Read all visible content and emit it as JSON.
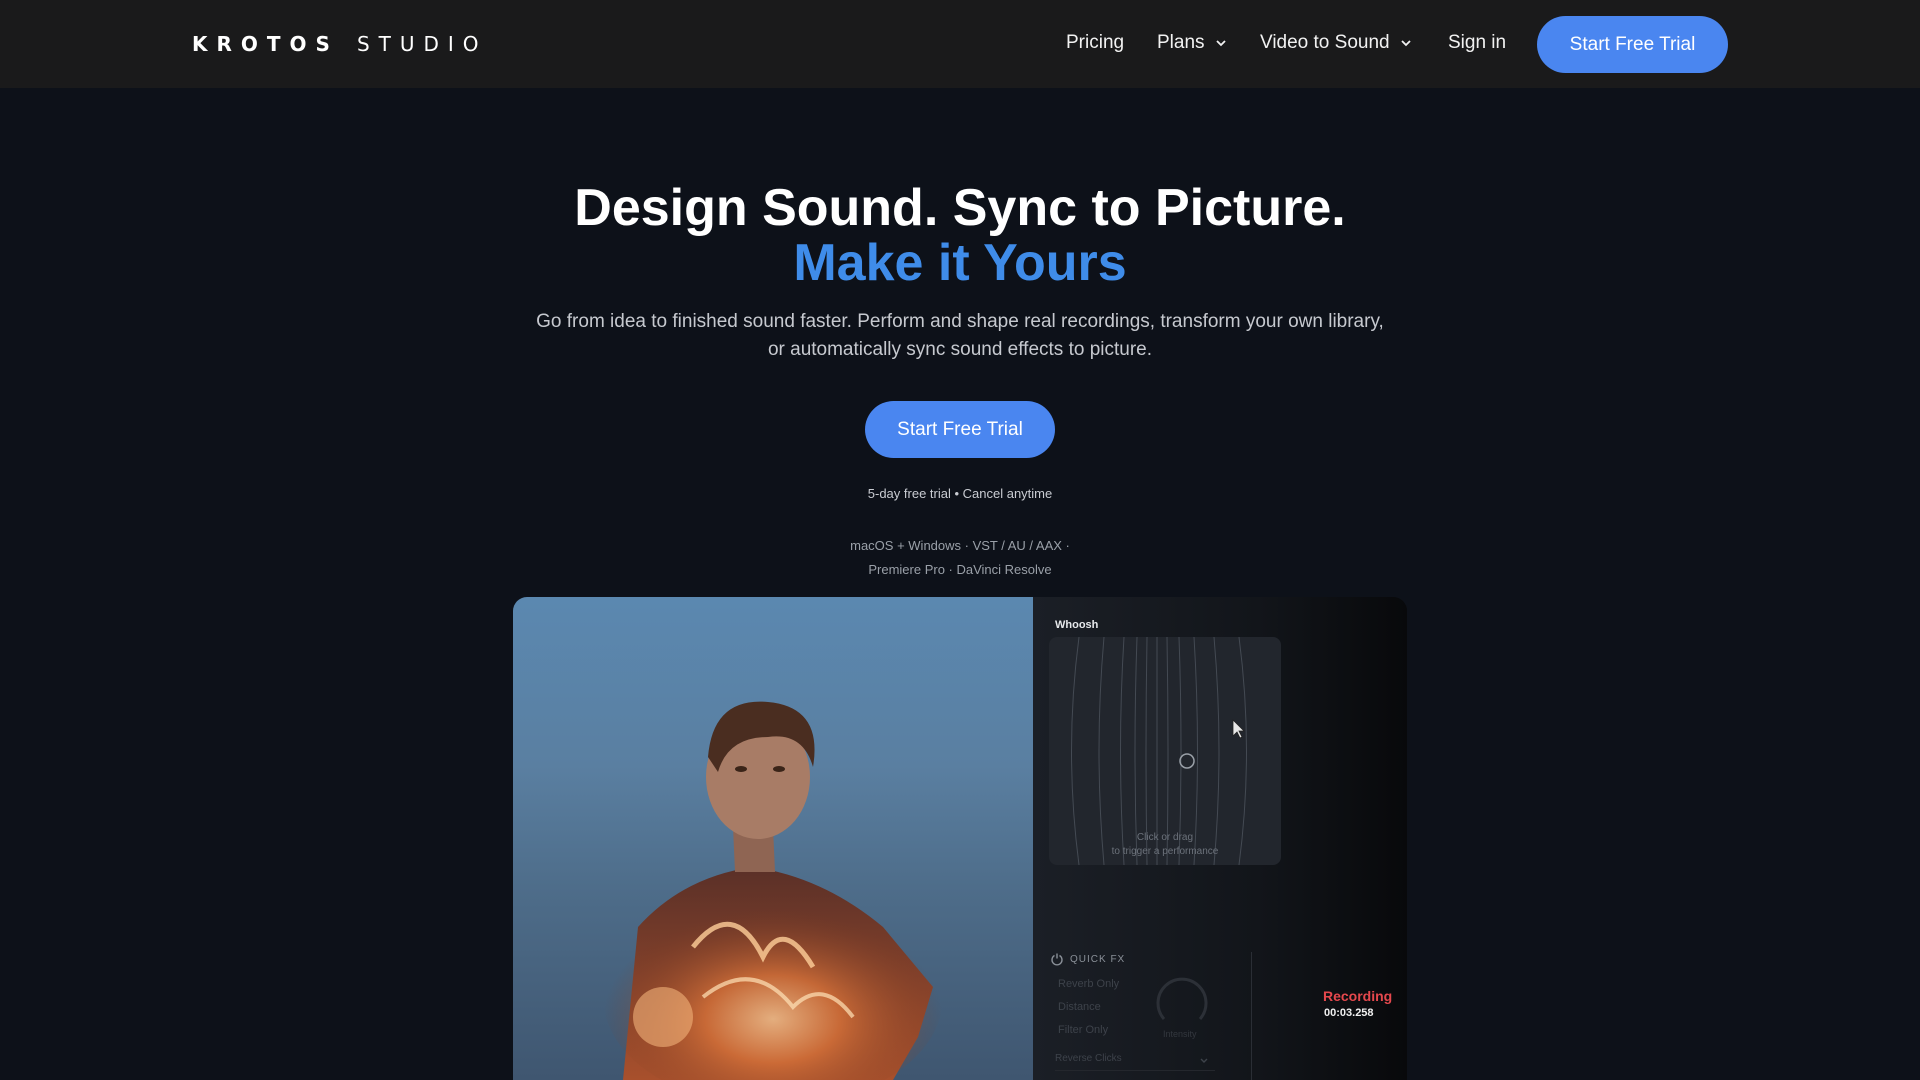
{
  "nav": {
    "logo_bold": "KROTOS",
    "logo_light": "STUDIO",
    "links": [
      {
        "label": "Pricing",
        "has_dropdown": false
      },
      {
        "label": "Plans",
        "has_dropdown": true
      },
      {
        "label": "Video to Sound",
        "has_dropdown": true
      },
      {
        "label": "Sign in",
        "has_dropdown": false
      }
    ],
    "cta_label": "Start Free Trial"
  },
  "hero": {
    "title": "Design Sound. Sync to Picture.",
    "title_accent": "Make it Yours",
    "subtitle_line1": "Go from idea to finished sound faster. Perform and shape real recordings, transform your own library,",
    "subtitle_line2": "or automatically sync sound effects to picture.",
    "cta_label": "Start Free Trial",
    "trial_note": "5-day free trial •  Cancel anytime",
    "compat_line1": "macOS + Windows · VST / AU / AAX ·",
    "compat_line2": "Premiere Pro · DaVinci Resolve"
  },
  "demo": {
    "preset_name": "Whoosh",
    "pad_hint_line1": "Click or drag",
    "pad_hint_line2": "to trigger a performance",
    "quick_fx_label": "QUICK FX",
    "fx_items": [
      "Reverb Only",
      "Distance",
      "Filter Only"
    ],
    "knob_label": "Intensity",
    "fx_select": "Reverse Clicks",
    "recording_label": "Recording",
    "recording_time": "00:03.258"
  },
  "colors": {
    "accent_blue": "#4a86f0",
    "title_accent": "#3f8ce9",
    "nav_bg": "#1a1a1b",
    "page_bg": "#0d1119",
    "recording_red": "#e5484d"
  }
}
